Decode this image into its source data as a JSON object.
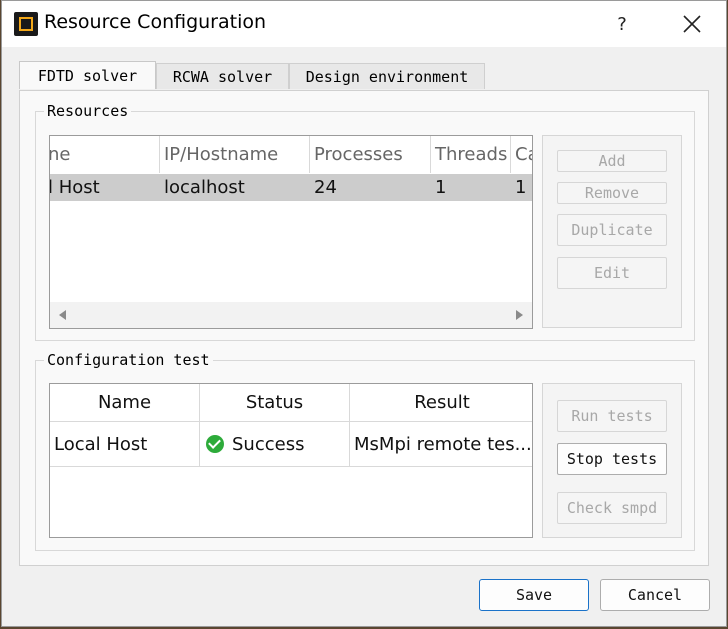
{
  "window": {
    "title": "Resource Configuration",
    "help": "?"
  },
  "tabs": [
    {
      "label": "FDTD solver",
      "active": true
    },
    {
      "label": "RCWA solver",
      "active": false
    },
    {
      "label": "Design environment",
      "active": false
    }
  ],
  "resources": {
    "title": "Resources",
    "columns": [
      "ne",
      "IP/Hostname",
      "Processes",
      "Threads",
      "Ca"
    ],
    "rows": [
      {
        "name": "l Host",
        "ip": "localhost",
        "processes": "24",
        "threads": "1",
        "ca": "1",
        "selected": true
      }
    ],
    "buttons": {
      "add": "Add",
      "remove": "Remove",
      "duplicate": "Duplicate",
      "edit": "Edit"
    }
  },
  "config_test": {
    "title": "Configuration test",
    "columns": [
      "Name",
      "Status",
      "Result"
    ],
    "rows": [
      {
        "name": "Local Host",
        "status": "Success",
        "status_icon": "check-circle-icon",
        "result": "MsMpi remote tes..."
      }
    ],
    "buttons": {
      "run": "Run tests",
      "stop": "Stop tests",
      "check": "Check smpd"
    }
  },
  "footer": {
    "save": "Save",
    "cancel": "Cancel"
  },
  "colors": {
    "accent": "#1a72c9",
    "success": "#2dab3a",
    "selection": "#cccccc"
  }
}
